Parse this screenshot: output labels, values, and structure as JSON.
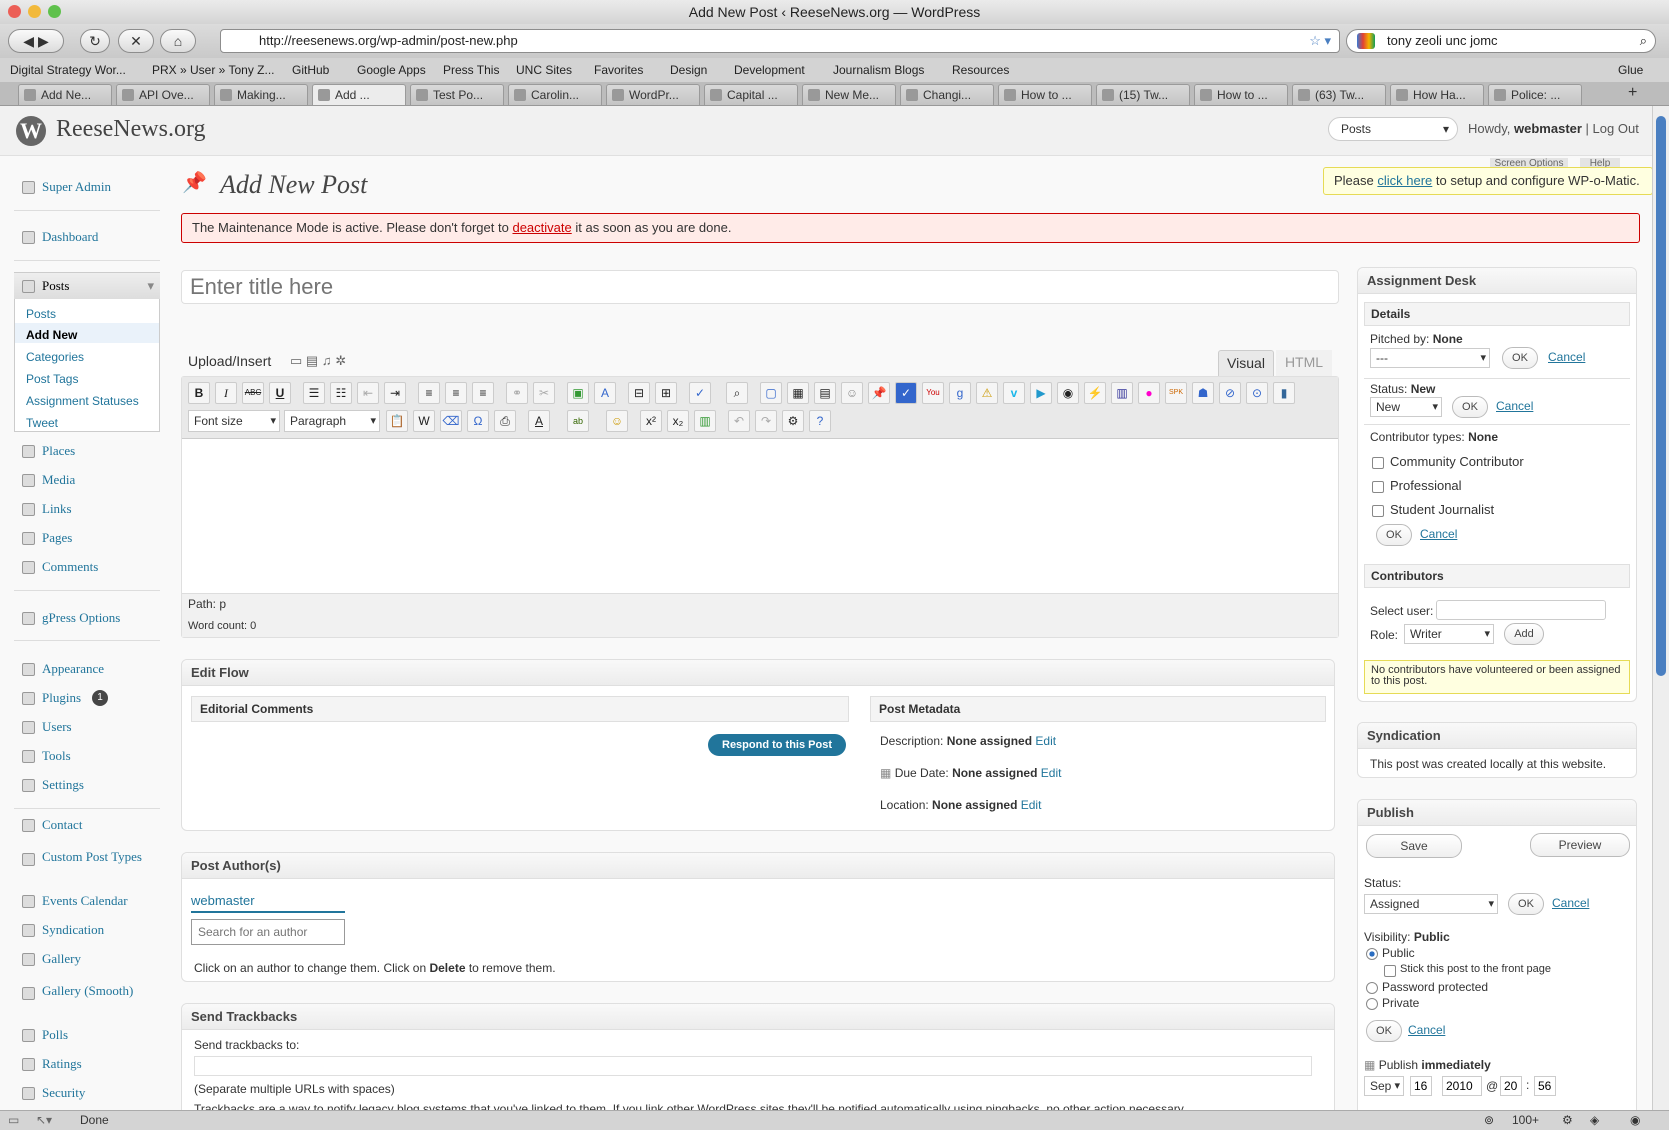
{
  "browser": {
    "window_title": "Add New Post ‹ ReeseNews.org — WordPress",
    "url": "http://reesenews.org/wp-admin/post-new.php",
    "search_value": "tony zeoli unc jomc",
    "bookmarks": [
      "Digital Strategy Wor...",
      "PRX » User » Tony Z...",
      "GitHub",
      "Google Apps",
      "Press This",
      "UNC Sites",
      "Favorites",
      "Design",
      "Development",
      "Journalism Blogs",
      "Resources",
      "Glue"
    ],
    "tabs": [
      "Add Ne...",
      "API Ove...",
      "Making...",
      "Add ...",
      "Test Po...",
      "Carolin...",
      "WordPr...",
      "Capital ...",
      "New Me...",
      "Changi...",
      "How to ...",
      "(15) Tw...",
      "How to ...",
      "(63) Tw...",
      "How Ha...",
      "Police: ..."
    ],
    "status": "Done",
    "zoom": "100+"
  },
  "header": {
    "site_name": "ReeseNews.org",
    "favorite_actions": "Posts",
    "howdy": "Howdy,",
    "user": "webmaster",
    "logout": "Log Out",
    "screen_options": "Screen Options",
    "help": "Help"
  },
  "menu": {
    "super_admin": "Super Admin",
    "dashboard": "Dashboard",
    "posts": "Posts",
    "posts_sub": [
      "Posts",
      "Add New",
      "Categories",
      "Post Tags",
      "Assignment Statuses",
      "Tweet"
    ],
    "group2": [
      "Places",
      "Media",
      "Links",
      "Pages",
      "Comments"
    ],
    "gpress": "gPress Options",
    "group3": [
      "Appearance",
      "Plugins",
      "Users",
      "Tools",
      "Settings"
    ],
    "plugins_badge": "1",
    "group4": [
      "Contact",
      "Custom Post Types",
      "Events Calendar",
      "Syndication",
      "Gallery",
      "Gallery (Smooth)",
      "Polls",
      "Ratings",
      "Security"
    ]
  },
  "page": {
    "title": "Add New Post",
    "notice_wpomatic_pre": "Please",
    "notice_wpomatic_link": "click here",
    "notice_wpomatic_post": "to setup and configure WP-o-Matic.",
    "maint_pre": "The Maintenance Mode is active. Please don't forget to",
    "maint_link": "deactivate",
    "maint_post": "it as soon as you are done.",
    "title_placeholder": "Enter title here"
  },
  "editor": {
    "upload_insert": "Upload/Insert",
    "visual_tab": "Visual",
    "html_tab": "HTML",
    "font_size": "Font size",
    "paragraph": "Paragraph",
    "path": "Path: p",
    "word_count": "Word count: 0"
  },
  "edit_flow": {
    "title": "Edit Flow",
    "comments_title": "Editorial Comments",
    "respond_button": "Respond to this Post",
    "metadata_title": "Post Metadata",
    "description_label": "Description:",
    "due_date_label": "Due Date:",
    "location_label": "Location:",
    "none_assigned": "None assigned",
    "edit": "Edit"
  },
  "post_authors": {
    "title": "Post Author(s)",
    "author": "webmaster",
    "search_placeholder": "Search for an author",
    "help_pre": "Click on an author to change them. Click on",
    "help_bold": "Delete",
    "help_post": "to remove them."
  },
  "trackbacks": {
    "title": "Send Trackbacks",
    "label": "Send trackbacks to:",
    "hint": "(Separate multiple URLs with spaces)",
    "desc": "Trackbacks are a way to notify legacy blog systems that you've linked to them. If you link other WordPress sites they'll be notified automatically using pingbacks, no other action necessary."
  },
  "assignment_desk": {
    "title": "Assignment Desk",
    "details": "Details",
    "pitched_by_label": "Pitched by:",
    "pitched_by_value": "None",
    "pitched_select": "---",
    "ok": "OK",
    "cancel": "Cancel",
    "status_label": "Status:",
    "status_value": "New",
    "status_select": "New",
    "contributor_types_label": "Contributor types:",
    "contributor_types_value": "None",
    "types": [
      "Community Contributor",
      "Professional",
      "Student Journalist"
    ],
    "contributors_title": "Contributors",
    "select_user": "Select user:",
    "role_label": "Role:",
    "role_value": "Writer",
    "add": "Add",
    "no_contributors": "No contributors have volunteered or been assigned to this post."
  },
  "syndication": {
    "title": "Syndication",
    "text": "This post was created locally at this website."
  },
  "publish": {
    "title": "Publish",
    "save": "Save",
    "preview": "Preview",
    "status_label": "Status:",
    "status_value": "Assigned",
    "ok": "OK",
    "cancel": "Cancel",
    "visibility_label": "Visibility:",
    "visibility_value": "Public",
    "public": "Public",
    "stick": "Stick this post to the front page",
    "password": "Password protected",
    "private": "Private",
    "publish_label": "Publish",
    "publish_value": "immediately",
    "month": "Sep",
    "day": "16",
    "year": "2010",
    "hour": "20",
    "minute": "56"
  }
}
